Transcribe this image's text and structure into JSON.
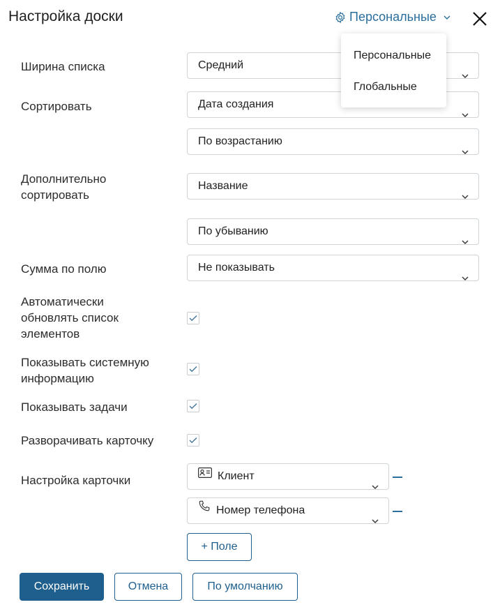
{
  "header": {
    "title": "Настройка доски",
    "scope_label": "Персональные"
  },
  "scope_menu": {
    "options": [
      "Персональные",
      "Глобальные"
    ]
  },
  "form": {
    "list_width": {
      "label": "Ширина списка",
      "value": "Средний"
    },
    "sort": {
      "label": "Сортировать",
      "field": "Дата создания",
      "order": "По возрастанию"
    },
    "extra_sort": {
      "label": "Дополнительно сортировать",
      "field": "Название",
      "order": "По убыванию"
    },
    "sum_field": {
      "label": "Сумма по полю",
      "value": "Не показывать"
    },
    "checkboxes": [
      {
        "label": "Автоматически обновлять список элементов",
        "checked": true
      },
      {
        "label": "Показывать системную информацию",
        "checked": true
      },
      {
        "label": "Показывать задачи",
        "checked": true
      },
      {
        "label": "Разворачивать карточку",
        "checked": true
      }
    ],
    "card_settings": {
      "label": "Настройка карточки",
      "fields": [
        {
          "value": "Клиент",
          "icon": "contact-card-icon"
        },
        {
          "value": "Номер телефона",
          "icon": "phone-icon"
        }
      ],
      "add_label": "+ Поле"
    }
  },
  "footer": {
    "save": "Сохранить",
    "cancel": "Отмена",
    "default": "По умолчанию"
  },
  "colors": {
    "accent": "#1f5f8e",
    "link": "#2a6e9d",
    "border": "#cfd4d8"
  }
}
